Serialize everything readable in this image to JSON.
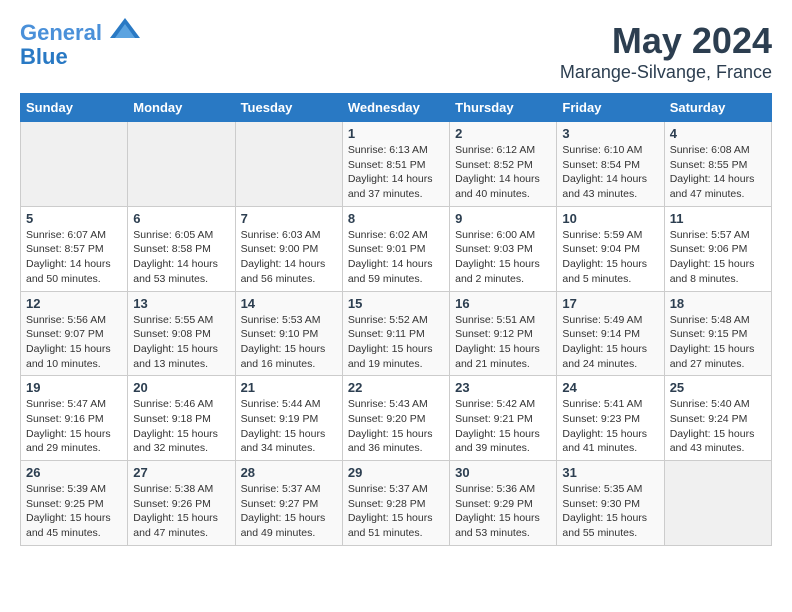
{
  "header": {
    "logo_line1": "General",
    "logo_line2": "Blue",
    "month": "May 2024",
    "location": "Marange-Silvange, France"
  },
  "weekdays": [
    "Sunday",
    "Monday",
    "Tuesday",
    "Wednesday",
    "Thursday",
    "Friday",
    "Saturday"
  ],
  "weeks": [
    [
      {
        "day": "",
        "info": ""
      },
      {
        "day": "",
        "info": ""
      },
      {
        "day": "",
        "info": ""
      },
      {
        "day": "1",
        "info": "Sunrise: 6:13 AM\nSunset: 8:51 PM\nDaylight: 14 hours and 37 minutes."
      },
      {
        "day": "2",
        "info": "Sunrise: 6:12 AM\nSunset: 8:52 PM\nDaylight: 14 hours and 40 minutes."
      },
      {
        "day": "3",
        "info": "Sunrise: 6:10 AM\nSunset: 8:54 PM\nDaylight: 14 hours and 43 minutes."
      },
      {
        "day": "4",
        "info": "Sunrise: 6:08 AM\nSunset: 8:55 PM\nDaylight: 14 hours and 47 minutes."
      }
    ],
    [
      {
        "day": "5",
        "info": "Sunrise: 6:07 AM\nSunset: 8:57 PM\nDaylight: 14 hours and 50 minutes."
      },
      {
        "day": "6",
        "info": "Sunrise: 6:05 AM\nSunset: 8:58 PM\nDaylight: 14 hours and 53 minutes."
      },
      {
        "day": "7",
        "info": "Sunrise: 6:03 AM\nSunset: 9:00 PM\nDaylight: 14 hours and 56 minutes."
      },
      {
        "day": "8",
        "info": "Sunrise: 6:02 AM\nSunset: 9:01 PM\nDaylight: 14 hours and 59 minutes."
      },
      {
        "day": "9",
        "info": "Sunrise: 6:00 AM\nSunset: 9:03 PM\nDaylight: 15 hours and 2 minutes."
      },
      {
        "day": "10",
        "info": "Sunrise: 5:59 AM\nSunset: 9:04 PM\nDaylight: 15 hours and 5 minutes."
      },
      {
        "day": "11",
        "info": "Sunrise: 5:57 AM\nSunset: 9:06 PM\nDaylight: 15 hours and 8 minutes."
      }
    ],
    [
      {
        "day": "12",
        "info": "Sunrise: 5:56 AM\nSunset: 9:07 PM\nDaylight: 15 hours and 10 minutes."
      },
      {
        "day": "13",
        "info": "Sunrise: 5:55 AM\nSunset: 9:08 PM\nDaylight: 15 hours and 13 minutes."
      },
      {
        "day": "14",
        "info": "Sunrise: 5:53 AM\nSunset: 9:10 PM\nDaylight: 15 hours and 16 minutes."
      },
      {
        "day": "15",
        "info": "Sunrise: 5:52 AM\nSunset: 9:11 PM\nDaylight: 15 hours and 19 minutes."
      },
      {
        "day": "16",
        "info": "Sunrise: 5:51 AM\nSunset: 9:12 PM\nDaylight: 15 hours and 21 minutes."
      },
      {
        "day": "17",
        "info": "Sunrise: 5:49 AM\nSunset: 9:14 PM\nDaylight: 15 hours and 24 minutes."
      },
      {
        "day": "18",
        "info": "Sunrise: 5:48 AM\nSunset: 9:15 PM\nDaylight: 15 hours and 27 minutes."
      }
    ],
    [
      {
        "day": "19",
        "info": "Sunrise: 5:47 AM\nSunset: 9:16 PM\nDaylight: 15 hours and 29 minutes."
      },
      {
        "day": "20",
        "info": "Sunrise: 5:46 AM\nSunset: 9:18 PM\nDaylight: 15 hours and 32 minutes."
      },
      {
        "day": "21",
        "info": "Sunrise: 5:44 AM\nSunset: 9:19 PM\nDaylight: 15 hours and 34 minutes."
      },
      {
        "day": "22",
        "info": "Sunrise: 5:43 AM\nSunset: 9:20 PM\nDaylight: 15 hours and 36 minutes."
      },
      {
        "day": "23",
        "info": "Sunrise: 5:42 AM\nSunset: 9:21 PM\nDaylight: 15 hours and 39 minutes."
      },
      {
        "day": "24",
        "info": "Sunrise: 5:41 AM\nSunset: 9:23 PM\nDaylight: 15 hours and 41 minutes."
      },
      {
        "day": "25",
        "info": "Sunrise: 5:40 AM\nSunset: 9:24 PM\nDaylight: 15 hours and 43 minutes."
      }
    ],
    [
      {
        "day": "26",
        "info": "Sunrise: 5:39 AM\nSunset: 9:25 PM\nDaylight: 15 hours and 45 minutes."
      },
      {
        "day": "27",
        "info": "Sunrise: 5:38 AM\nSunset: 9:26 PM\nDaylight: 15 hours and 47 minutes."
      },
      {
        "day": "28",
        "info": "Sunrise: 5:37 AM\nSunset: 9:27 PM\nDaylight: 15 hours and 49 minutes."
      },
      {
        "day": "29",
        "info": "Sunrise: 5:37 AM\nSunset: 9:28 PM\nDaylight: 15 hours and 51 minutes."
      },
      {
        "day": "30",
        "info": "Sunrise: 5:36 AM\nSunset: 9:29 PM\nDaylight: 15 hours and 53 minutes."
      },
      {
        "day": "31",
        "info": "Sunrise: 5:35 AM\nSunset: 9:30 PM\nDaylight: 15 hours and 55 minutes."
      },
      {
        "day": "",
        "info": ""
      }
    ]
  ]
}
